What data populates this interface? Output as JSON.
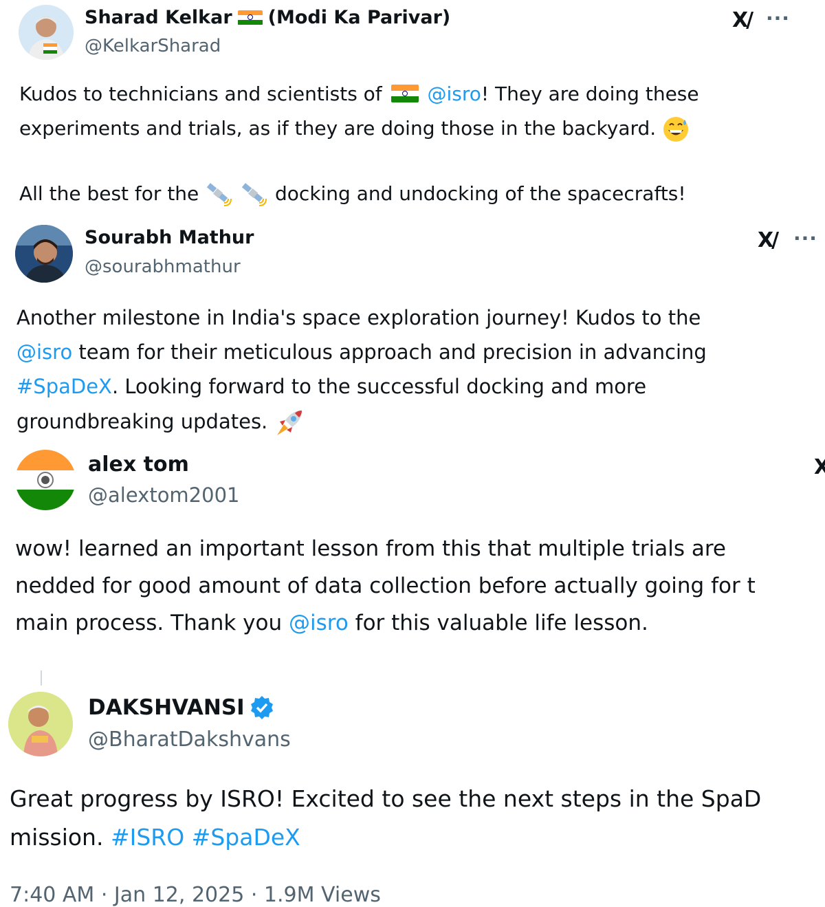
{
  "colors": {
    "link": "#1d9bf0",
    "text": "#0f1419",
    "muted": "#536471",
    "verified": "#1d9bf0"
  },
  "tweets": [
    {
      "name": "Sharad Kelkar",
      "name_suffix": "(Modi Ka Parivar)",
      "handle": "@KelkarSharad",
      "line1_a": "Kudos to technicians and scientists of",
      "line1_mention": "@isro",
      "line1_b": "! They are doing these",
      "line2": "experiments and trials, as if they are doing those in the backyard.",
      "line3_a": "All the best for the",
      "line3_b": "docking and undocking of the spacecrafts!",
      "grok_label": "X/",
      "more_label": "···",
      "emoji": [
        "flag-india-icon",
        "grinning-sweat-icon",
        "satellite-icon",
        "satellite-icon"
      ]
    },
    {
      "name": "Sourabh Mathur",
      "handle": "@sourabhmathur",
      "line1": "Another milestone in India's space exploration journey! Kudos to the",
      "line2_mention": "@isro",
      "line2_b": " team for their meticulous approach and precision in advancing",
      "line3_hashtag": "#SpaDeX",
      "line3_b": ". Looking forward to the successful docking and more",
      "line4": "groundbreaking updates.",
      "grok_label": "X/",
      "more_label": "···",
      "emoji": [
        "rocket-icon"
      ]
    },
    {
      "name": "alex tom",
      "handle": "@alextom2001",
      "line1": "wow! learned an important lesson from this that multiple trials are",
      "line2": "nedded for good amount of data collection before actually going for t",
      "line3_a": "main process. Thank you ",
      "line3_mention": "@isro",
      "line3_b": " for this valuable life lesson.",
      "grok_label": "X"
    },
    {
      "name": "DAKSHVANSI",
      "handle": "@BharatDakshvans",
      "line1": "Great progress by ISRO! Excited to see the next steps in the SpaD",
      "line2_a": "mission. ",
      "line2_hashtags": "#ISRO #SpaDeX",
      "footer_partial": "7:40 AM · Jan 12, 2025 · 1.9M Views"
    }
  ]
}
